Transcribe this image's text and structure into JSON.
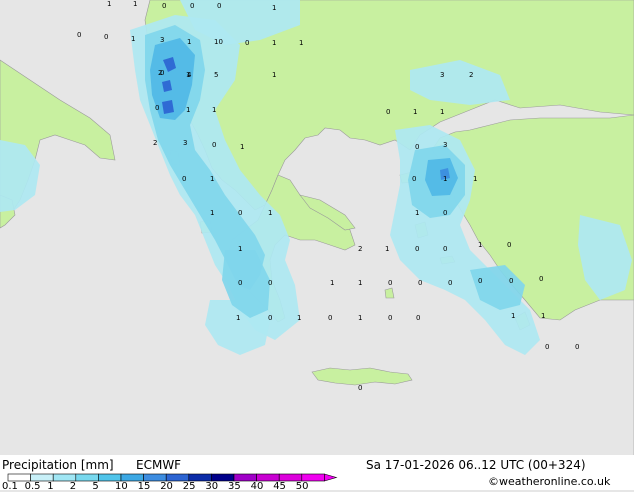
{
  "title": {
    "left": "Precipitation [mm]",
    "model": "ECMWF",
    "datetime": "Sa 17-01-2026 06..12 UTC (00+324)",
    "credit": "©weatheronline.co.uk"
  },
  "legend": {
    "ticks": [
      "0.1",
      "0.5",
      "1",
      "2",
      "5",
      "10",
      "15",
      "20",
      "25",
      "30",
      "35",
      "40",
      "45",
      "50"
    ],
    "colors": [
      "#ffffff",
      "#c8f0f8",
      "#a0e6f4",
      "#78d8ee",
      "#50c4ea",
      "#3ca8e4",
      "#3c8ce0",
      "#2c64d2",
      "#0c2ca8",
      "#00008a",
      "#a000c8",
      "#c800d2",
      "#dc00dc",
      "#f000f0"
    ]
  },
  "map": {
    "colors": {
      "sea": "#e6e6e6",
      "land": "#c8f0a0",
      "precip_light": "#aee8f2",
      "precip_moderate": "#80d6ec",
      "precip_heavy": "#50b8e6",
      "precip_very_heavy": "#2c64d2"
    },
    "values": [
      "1",
      "1",
      "0",
      "0",
      "0",
      "1",
      "0",
      "0",
      "1",
      "3",
      "1",
      "10",
      "0",
      "1",
      "1",
      "0",
      "1",
      "2",
      "4",
      "5",
      "1",
      "3",
      "2",
      "0",
      "1",
      "1",
      "0",
      "1",
      "1",
      "2",
      "3",
      "0",
      "1",
      "0",
      "3",
      "0",
      "1",
      "0",
      "1",
      "1",
      "1",
      "0",
      "1",
      "1",
      "0",
      "1",
      "2",
      "1",
      "0",
      "0",
      "1",
      "0",
      "0",
      "0",
      "1",
      "1",
      "0",
      "0",
      "0",
      "0",
      "0",
      "0",
      "1",
      "0",
      "1",
      "0",
      "1",
      "0",
      "0",
      "1",
      "1",
      "0",
      "0",
      "0",
      "0",
      "1",
      "0",
      "0"
    ]
  }
}
